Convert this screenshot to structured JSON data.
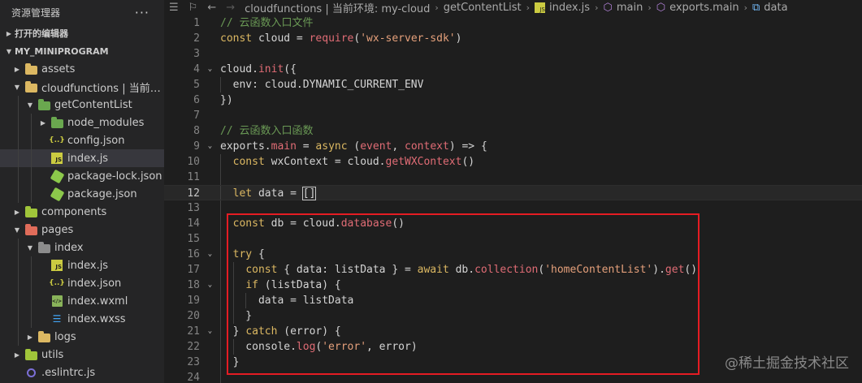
{
  "sidebar": {
    "title": "资源管理器",
    "more": "···",
    "open_editors": "打开的编辑器",
    "project": "MY_MINIPROGRAM",
    "items": [
      {
        "label": "assets",
        "depth": 1,
        "type": "folder",
        "color": "#dcb862",
        "expanded": false
      },
      {
        "label": "cloudfunctions | 当前环境: my-cloud",
        "depth": 1,
        "type": "folder",
        "color": "#dcb862",
        "expanded": true
      },
      {
        "label": "getContentList",
        "depth": 2,
        "type": "folder",
        "color": "#6aa84f",
        "expanded": true
      },
      {
        "label": "node_modules",
        "depth": 3,
        "type": "folder",
        "color": "#6aa84f",
        "expanded": false
      },
      {
        "label": "config.json",
        "depth": 3,
        "type": "json"
      },
      {
        "label": "index.js",
        "depth": 3,
        "type": "js",
        "active": true
      },
      {
        "label": "package-lock.json",
        "depth": 3,
        "type": "node"
      },
      {
        "label": "package.json",
        "depth": 3,
        "type": "node"
      },
      {
        "label": "components",
        "depth": 1,
        "type": "folder",
        "color": "#a0c53a",
        "expanded": false
      },
      {
        "label": "pages",
        "depth": 1,
        "type": "folder",
        "color": "#e06c5a",
        "expanded": true
      },
      {
        "label": "index",
        "depth": 2,
        "type": "folder",
        "color": "#8c8c8c",
        "expanded": true
      },
      {
        "label": "index.js",
        "depth": 3,
        "type": "js"
      },
      {
        "label": "index.json",
        "depth": 3,
        "type": "json"
      },
      {
        "label": "index.wxml",
        "depth": 3,
        "type": "wxml"
      },
      {
        "label": "index.wxss",
        "depth": 3,
        "type": "css"
      },
      {
        "label": "logs",
        "depth": 2,
        "type": "folder",
        "color": "#dcb862",
        "expanded": false
      },
      {
        "label": "utils",
        "depth": 1,
        "type": "folder",
        "color": "#a0c53a",
        "expanded": false
      },
      {
        "label": ".eslintrc.js",
        "depth": 1,
        "type": "eslint"
      }
    ]
  },
  "breadcrumbs": [
    "cloudfunctions | 当前环境: my-cloud",
    "getContentList",
    "index.js",
    "main",
    "exports.main",
    "data"
  ],
  "editor": {
    "lines": [
      {
        "n": "1",
        "indent": 0,
        "tokens": [
          [
            "cm",
            "// 云函数入口文件"
          ]
        ]
      },
      {
        "n": "2",
        "indent": 0,
        "tokens": [
          [
            "kw",
            "const"
          ],
          [
            "plain",
            " cloud = "
          ],
          [
            "fn",
            "require"
          ],
          [
            "plain",
            "("
          ],
          [
            "str",
            "'wx-server-sdk'"
          ],
          [
            "plain",
            ")"
          ]
        ]
      },
      {
        "n": "3",
        "indent": 0,
        "tokens": []
      },
      {
        "n": "4",
        "indent": 0,
        "fold": true,
        "tokens": [
          [
            "plain",
            "cloud."
          ],
          [
            "fn",
            "init"
          ],
          [
            "plain",
            "({"
          ]
        ]
      },
      {
        "n": "5",
        "indent": 1,
        "tokens": [
          [
            "plain",
            "  env: cloud.DYNAMIC_CURRENT_ENV"
          ]
        ]
      },
      {
        "n": "6",
        "indent": 0,
        "tokens": [
          [
            "plain",
            "})"
          ]
        ]
      },
      {
        "n": "7",
        "indent": 0,
        "tokens": []
      },
      {
        "n": "8",
        "indent": 0,
        "tokens": [
          [
            "cm",
            "// 云函数入口函数"
          ]
        ]
      },
      {
        "n": "9",
        "indent": 0,
        "fold": true,
        "tokens": [
          [
            "plain",
            "exports."
          ],
          [
            "fn",
            "main"
          ],
          [
            "plain",
            " = "
          ],
          [
            "kw",
            "async"
          ],
          [
            "plain",
            " ("
          ],
          [
            "param",
            "event"
          ],
          [
            "plain",
            ", "
          ],
          [
            "param",
            "context"
          ],
          [
            "plain",
            ") => {"
          ]
        ]
      },
      {
        "n": "10",
        "indent": 1,
        "tokens": [
          [
            "plain",
            "  "
          ],
          [
            "kw",
            "const"
          ],
          [
            "plain",
            " wxContext = cloud."
          ],
          [
            "fn",
            "getWXContext"
          ],
          [
            "plain",
            "()"
          ]
        ]
      },
      {
        "n": "11",
        "indent": 1,
        "tokens": []
      },
      {
        "n": "12",
        "indent": 1,
        "current": true,
        "tokens": [
          [
            "plain",
            "  "
          ],
          [
            "kw",
            "let"
          ],
          [
            "plain",
            " data = "
          ],
          [
            "cursor",
            "[]"
          ]
        ]
      },
      {
        "n": "13",
        "indent": 1,
        "tokens": []
      },
      {
        "n": "14",
        "indent": 1,
        "tokens": [
          [
            "plain",
            "  "
          ],
          [
            "kw",
            "const"
          ],
          [
            "plain",
            " db = cloud."
          ],
          [
            "fn",
            "database"
          ],
          [
            "plain",
            "()"
          ]
        ]
      },
      {
        "n": "15",
        "indent": 1,
        "tokens": []
      },
      {
        "n": "16",
        "indent": 1,
        "fold": true,
        "tokens": [
          [
            "plain",
            "  "
          ],
          [
            "kw",
            "try"
          ],
          [
            "plain",
            " {"
          ]
        ]
      },
      {
        "n": "17",
        "indent": 2,
        "tokens": [
          [
            "plain",
            "    "
          ],
          [
            "kw",
            "const"
          ],
          [
            "plain",
            " { data: listData } = "
          ],
          [
            "kw",
            "await"
          ],
          [
            "plain",
            " db."
          ],
          [
            "fn",
            "collection"
          ],
          [
            "plain",
            "("
          ],
          [
            "str",
            "'homeContentList'"
          ],
          [
            "plain",
            ")."
          ],
          [
            "fn",
            "get"
          ],
          [
            "plain",
            "()"
          ]
        ]
      },
      {
        "n": "18",
        "indent": 2,
        "fold": true,
        "tokens": [
          [
            "plain",
            "    "
          ],
          [
            "kw",
            "if"
          ],
          [
            "plain",
            " (listData) {"
          ]
        ]
      },
      {
        "n": "19",
        "indent": 3,
        "tokens": [
          [
            "plain",
            "      data = listData"
          ]
        ]
      },
      {
        "n": "20",
        "indent": 2,
        "tokens": [
          [
            "plain",
            "    }"
          ]
        ]
      },
      {
        "n": "21",
        "indent": 1,
        "fold": true,
        "tokens": [
          [
            "plain",
            "  } "
          ],
          [
            "kw",
            "catch"
          ],
          [
            "plain",
            " (error) {"
          ]
        ]
      },
      {
        "n": "22",
        "indent": 2,
        "tokens": [
          [
            "plain",
            "    console."
          ],
          [
            "fn",
            "log"
          ],
          [
            "plain",
            "("
          ],
          [
            "str",
            "'error'"
          ],
          [
            "plain",
            ", error)"
          ]
        ]
      },
      {
        "n": "23",
        "indent": 1,
        "tokens": [
          [
            "plain",
            "  }"
          ]
        ]
      },
      {
        "n": "24",
        "indent": 1,
        "tokens": []
      }
    ]
  },
  "watermark": "@稀土掘金技术社区"
}
